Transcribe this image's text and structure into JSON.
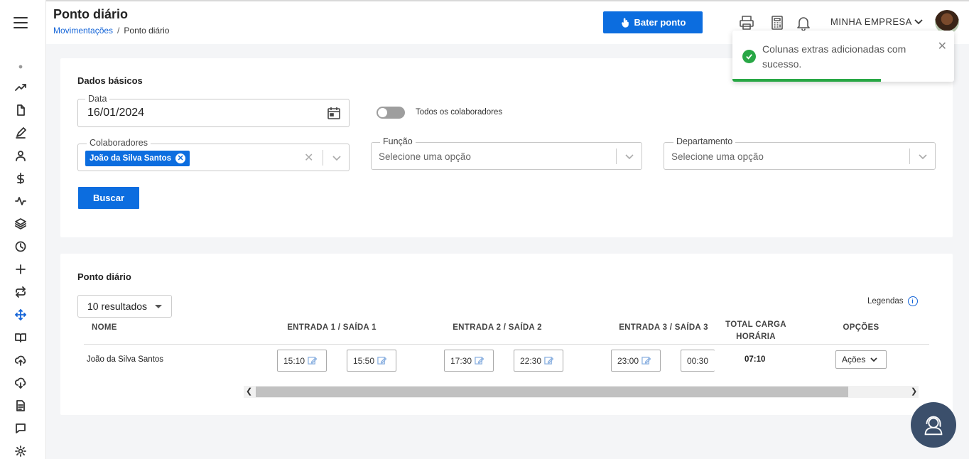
{
  "header": {
    "title": "Ponto diário",
    "breadcrumb": {
      "parent": "Movimentações",
      "separator": "/",
      "current": "Ponto diário"
    },
    "bater_ponto_label": "Bater ponto",
    "company": "MINHA EMPRESA"
  },
  "sidebar": {
    "icons": [
      "dot-icon",
      "trending-up-icon",
      "file-icon",
      "pen-icon",
      "user-icon",
      "dollar-icon",
      "activity-icon",
      "layers-icon",
      "clock-icon",
      "plus-icon",
      "repeat-icon",
      "move-icon",
      "book-icon",
      "upload-cloud-icon",
      "download-cloud-icon",
      "document-icon",
      "message-icon",
      "settings-icon"
    ],
    "active": "move-icon"
  },
  "basic": {
    "title": "Dados básicos",
    "date_label": "Data",
    "date_value": "16/01/2024",
    "toggle_label": "Todos os colaboradores",
    "toggle_on": false,
    "colaboradores_label": "Colaboradores",
    "colaborador_chip": "João da Silva Santos",
    "funcao_label": "Função",
    "funcao_placeholder": "Selecione uma opção",
    "departamento_label": "Departamento",
    "departamento_placeholder": "Selecione uma opção",
    "buscar_label": "Buscar"
  },
  "daily": {
    "title": "Ponto diário",
    "results_label": "10 resultados",
    "legend_label": "Legendas",
    "columns": {
      "nome": "NOME",
      "es1": "ENTRADA 1 / SAÍDA 1",
      "es2": "ENTRADA 2 / SAÍDA 2",
      "es3": "ENTRADA 3 / SAÍDA 3",
      "total": "TOTAL CARGA HORÁRIA",
      "opcoes": "OPÇÕES"
    },
    "rows": [
      {
        "nome": "João da Silva Santos",
        "times": [
          "15:10",
          "15:50",
          "17:30",
          "22:30",
          "23:00",
          "00:30"
        ],
        "total": "07:10",
        "acoes": "Ações"
      }
    ]
  },
  "toast": {
    "message": "Colunas extras adicionadas com sucesso.",
    "progress": 0.67,
    "color": "#28a745"
  },
  "colors": {
    "primary": "#0c6ddf",
    "success": "#28a745",
    "support": "#3b4f6b"
  }
}
